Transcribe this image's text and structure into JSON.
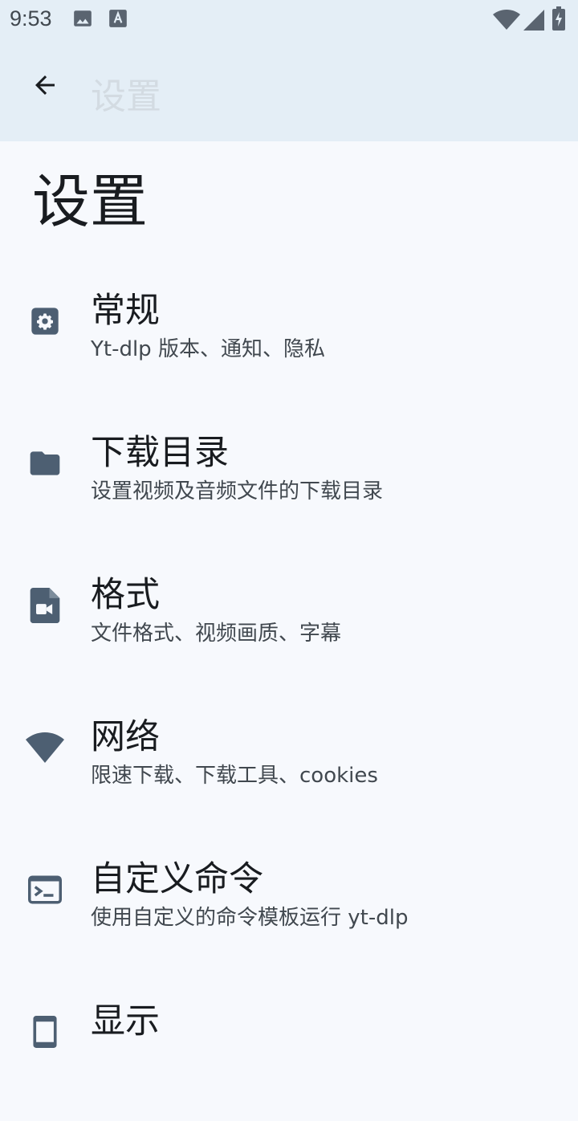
{
  "status_bar": {
    "time": "9:53",
    "icons": [
      "image-icon",
      "text-a-icon",
      "wifi-icon",
      "cellular-icon",
      "battery-icon"
    ]
  },
  "app_bar": {
    "back_icon": "arrow-back-icon",
    "title": "设置"
  },
  "page": {
    "title": "设置"
  },
  "settings": {
    "items": [
      {
        "icon": "gear-icon",
        "title": "常规",
        "subtitle": "Yt-dlp 版本、通知、隐私"
      },
      {
        "icon": "folder-icon",
        "title": "下载目录",
        "subtitle": "设置视频及音频文件的下载目录"
      },
      {
        "icon": "video-file-icon",
        "title": "格式",
        "subtitle": "文件格式、视频画质、字幕"
      },
      {
        "icon": "wifi-icon",
        "title": "网络",
        "subtitle": "限速下载、下载工具、cookies"
      },
      {
        "icon": "terminal-icon",
        "title": "自定义命令",
        "subtitle": "使用自定义的命令模板运行 yt-dlp"
      },
      {
        "icon": "display-icon",
        "title": "显示",
        "subtitle": ""
      }
    ]
  },
  "colors": {
    "app_bar_bg": "#e4eef6",
    "page_bg": "#f7f9fd",
    "icon": "#4d5f72",
    "title_text": "#191c20",
    "subtitle_text": "#41484f"
  }
}
